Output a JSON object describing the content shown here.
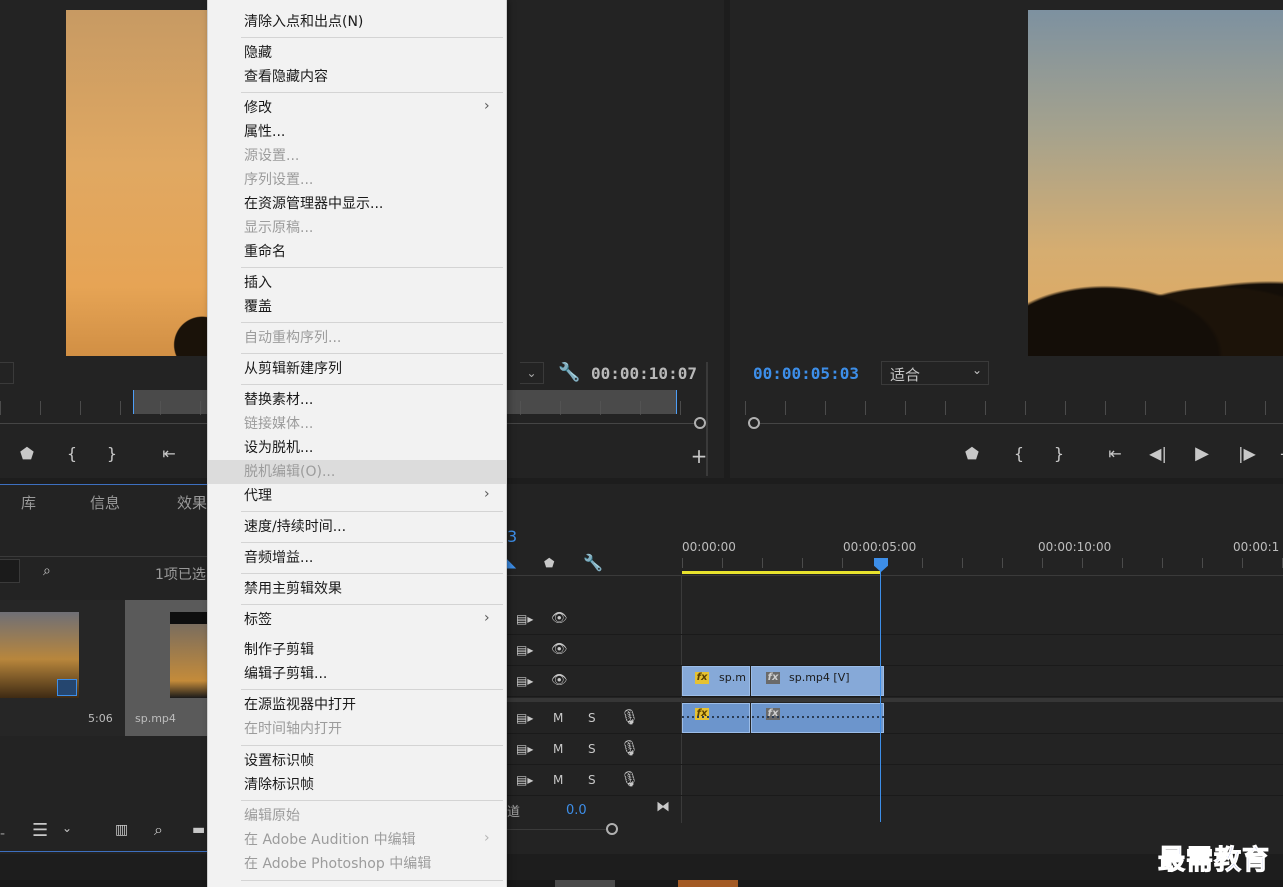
{
  "source_monitor": {
    "timecode": "00:00:10:07"
  },
  "program_monitor": {
    "timecode": "00:00:05:03",
    "fit_select": "适合"
  },
  "project_panel": {
    "tabs": [
      "库",
      "信息",
      "效果"
    ],
    "selection_status": "1项已选",
    "clip1_duration": "5:06",
    "clip2_name": "sp.mp4"
  },
  "timeline": {
    "ruler_labels": [
      "00:00:00",
      "00:00:05:00",
      "00:00:10:00",
      "00:00:1"
    ],
    "seq_number": "3",
    "track_m": "M",
    "track_s": "S",
    "master_label": "道",
    "master_value": "0.0",
    "clip_v1_label": "sp.m",
    "clip_v2_label": "sp.mp4 [V]",
    "fx": "fx"
  },
  "context_menu": {
    "items": [
      {
        "label": "清除入点和出点(N)",
        "disabled": false
      },
      {
        "label": "隐藏",
        "disabled": false
      },
      {
        "label": "查看隐藏内容",
        "disabled": false
      },
      {
        "label": "修改",
        "disabled": false,
        "submenu": true
      },
      {
        "label": "属性...",
        "disabled": false
      },
      {
        "label": "源设置...",
        "disabled": true
      },
      {
        "label": "序列设置...",
        "disabled": true
      },
      {
        "label": "在资源管理器中显示...",
        "disabled": false
      },
      {
        "label": "显示原稿...",
        "disabled": true
      },
      {
        "label": "重命名",
        "disabled": false
      },
      {
        "label": "插入",
        "disabled": false
      },
      {
        "label": "覆盖",
        "disabled": false
      },
      {
        "label": "自动重构序列...",
        "disabled": true
      },
      {
        "label": "从剪辑新建序列",
        "disabled": false
      },
      {
        "label": "替换素材...",
        "disabled": false
      },
      {
        "label": "链接媒体...",
        "disabled": true
      },
      {
        "label": "设为脱机...",
        "disabled": false
      },
      {
        "label": "脱机编辑(O)...",
        "disabled": true
      },
      {
        "label": "代理",
        "disabled": false,
        "submenu": true
      },
      {
        "label": "速度/持续时间...",
        "disabled": false
      },
      {
        "label": "音频增益...",
        "disabled": false
      },
      {
        "label": "禁用主剪辑效果",
        "disabled": false
      },
      {
        "label": "标签",
        "disabled": false,
        "submenu": true
      },
      {
        "label": "制作子剪辑",
        "disabled": false
      },
      {
        "label": "编辑子剪辑...",
        "disabled": false
      },
      {
        "label": "在源监视器中打开",
        "disabled": false
      },
      {
        "label": "在时间轴内打开",
        "disabled": true
      },
      {
        "label": "设置标识帧",
        "disabled": false
      },
      {
        "label": "清除标识帧",
        "disabled": false
      },
      {
        "label": "编辑原始",
        "disabled": true
      },
      {
        "label": "在 Adobe Audition 中编辑",
        "disabled": true,
        "submenu": true
      },
      {
        "label": "在 Adobe Photoshop 中编辑",
        "disabled": true
      }
    ]
  },
  "watermark": "最需教育",
  "colors": {
    "accent_blue": "#3d8ee8",
    "menu_bg": "#f2f2f2",
    "clip_blue": "#86a9d8",
    "workbar_yellow": "#e8e22d",
    "watermark": "#1f34b8"
  }
}
